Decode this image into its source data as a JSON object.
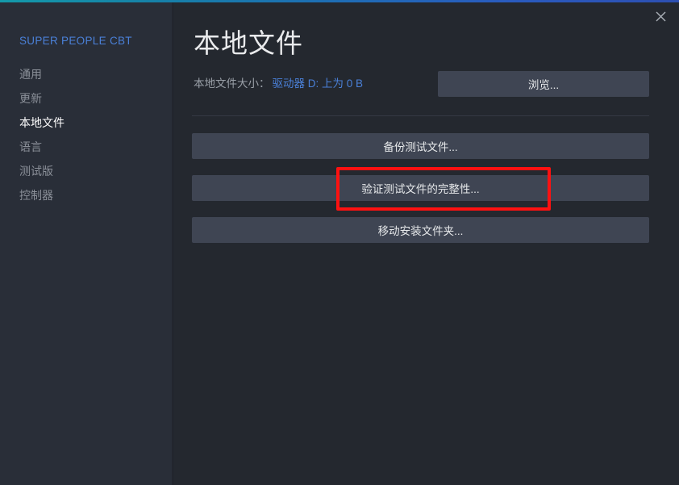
{
  "window": {
    "close_label": "×",
    "accent_start": "#149aaa",
    "accent_end": "#2d4fb2"
  },
  "sidebar": {
    "title": "SUPER PEOPLE CBT",
    "title_color": "#4a80d8",
    "items": [
      {
        "label": "通用",
        "active": false
      },
      {
        "label": "更新",
        "active": false
      },
      {
        "label": "本地文件",
        "active": true
      },
      {
        "label": "语言",
        "active": false
      },
      {
        "label": "测试版",
        "active": false
      },
      {
        "label": "控制器",
        "active": false
      }
    ]
  },
  "main": {
    "page_title": "本地文件",
    "size_row": {
      "label": "本地文件大小：",
      "value": "驱动器 D: 上为 0 B",
      "value_color": "#4a80d8"
    },
    "browse_button": "浏览...",
    "actions": [
      {
        "label": "备份测试文件..."
      },
      {
        "label": "验证测试文件的完整性..."
      },
      {
        "label": "移动安装文件夹..."
      }
    ]
  },
  "annotation": {
    "color": "#fd1111",
    "target": "验证测试文件的完整性..."
  }
}
